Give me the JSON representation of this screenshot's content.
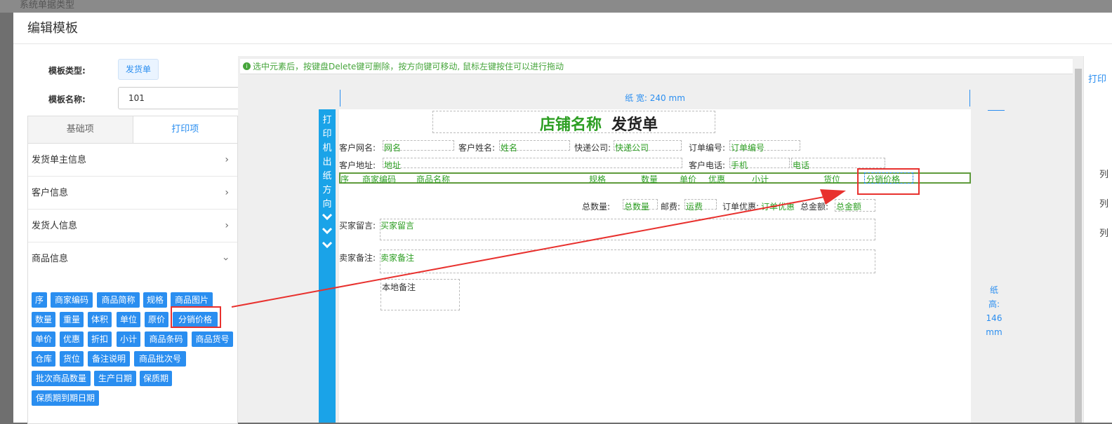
{
  "background": {
    "title": "系统单据类型"
  },
  "modal": {
    "title": "编辑模板"
  },
  "form": {
    "type_label": "模板类型:",
    "type_value": "发货单",
    "name_label": "模板名称:",
    "name_value": "101"
  },
  "tabs": [
    {
      "label": "基础项"
    },
    {
      "label": "打印项"
    }
  ],
  "accordion": [
    {
      "label": "发货单主信息"
    },
    {
      "label": "客户信息"
    },
    {
      "label": "发货人信息"
    },
    {
      "label": "商品信息"
    }
  ],
  "chips": [
    "序",
    "商家编码",
    "商品简称",
    "规格",
    "商品图片",
    "数量",
    "重量",
    "体积",
    "单位",
    "原价",
    "分销价格",
    "单价",
    "优惠",
    "折扣",
    "小计",
    "商品条码",
    "商品货号",
    "仓库",
    "货位",
    "备注说明",
    "商品批次号",
    "批次商品数量",
    "生产日期",
    "保质期",
    "保质期到期日期"
  ],
  "tip": "选中元素后，按键盘Delete键可删除，按方向键可移动, 鼠标左键按住可以进行拖动",
  "ruler": {
    "width": "纸 宽: 240 mm",
    "height": [
      "纸",
      "高:",
      "146",
      "mm"
    ]
  },
  "sidebar_text": [
    "打",
    "印",
    "机",
    "出",
    "纸",
    "方",
    "向"
  ],
  "paper": {
    "title_store": "店铺名称",
    "title_doc": "发货单",
    "customer_net_label": "客户网名:",
    "customer_net_value": "网名",
    "customer_name_label": "客户姓名:",
    "customer_name_value": "姓名",
    "courier_label": "快递公司:",
    "courier_value": "快递公司",
    "order_no_label": "订单编号:",
    "order_no_value": "订单编号",
    "address_label": "客户地址:",
    "address_value": "地址",
    "phone_label": "客户电话:",
    "mobile_value": "手机",
    "tel_value": "电话",
    "columns": [
      "序",
      "商家编码",
      "商品名称",
      "规格",
      "数量",
      "单价",
      "优惠",
      "小计",
      "货位",
      "分销价格"
    ],
    "total_qty_label": "总数量:",
    "total_qty_value": "总数量",
    "postage_label": "邮费:",
    "postage_value": "运费",
    "order_discount_label": "订单优惠:",
    "order_discount_value": "订单优惠",
    "total_amount_label": "总金额:",
    "total_amount_value": "总金额",
    "buyer_msg_label": "买家留言:",
    "buyer_msg_value": "买家留言",
    "seller_note_label": "卖家备注:",
    "seller_note_value": "卖家备注",
    "local_note_value": "本地备注"
  },
  "right_panel": {
    "title": "打印",
    "rows": [
      "列",
      "列",
      "列"
    ]
  },
  "colors": {
    "accent": "#2a8ef0",
    "green": "#2c9e22",
    "highlight": "#e8312e"
  }
}
